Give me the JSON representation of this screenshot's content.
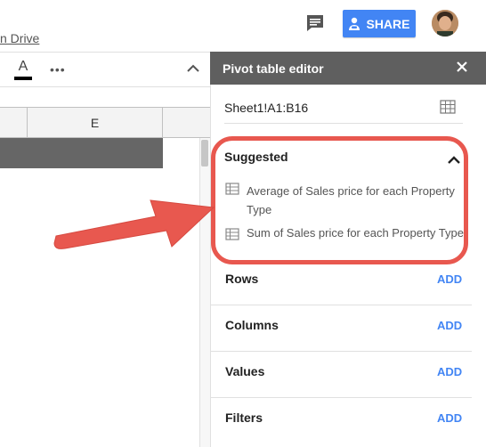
{
  "header": {
    "drive_link": "n Drive",
    "share_label": "SHARE"
  },
  "toolbar": {
    "text_color_letter": "A",
    "more_label": "•••"
  },
  "grid": {
    "column_header": "E"
  },
  "panel": {
    "title": "Pivot table editor",
    "range": "Sheet1!A1:B16",
    "suggested": {
      "title": "Suggested",
      "items": [
        "Average of Sales price for each Property Type",
        "Sum of Sales price for each Property Type"
      ]
    },
    "sections": [
      {
        "label": "Rows",
        "action": "ADD"
      },
      {
        "label": "Columns",
        "action": "ADD"
      },
      {
        "label": "Values",
        "action": "ADD"
      },
      {
        "label": "Filters",
        "action": "ADD"
      }
    ]
  },
  "colors": {
    "accent": "#4285f4",
    "highlight": "#e8584f",
    "panel_header": "#5f5f5f"
  },
  "icons": [
    "comment-icon",
    "person-add-icon",
    "avatar",
    "more-icon",
    "chevron-up-icon",
    "close-icon",
    "table-grid-icon",
    "arrow-annotation"
  ]
}
